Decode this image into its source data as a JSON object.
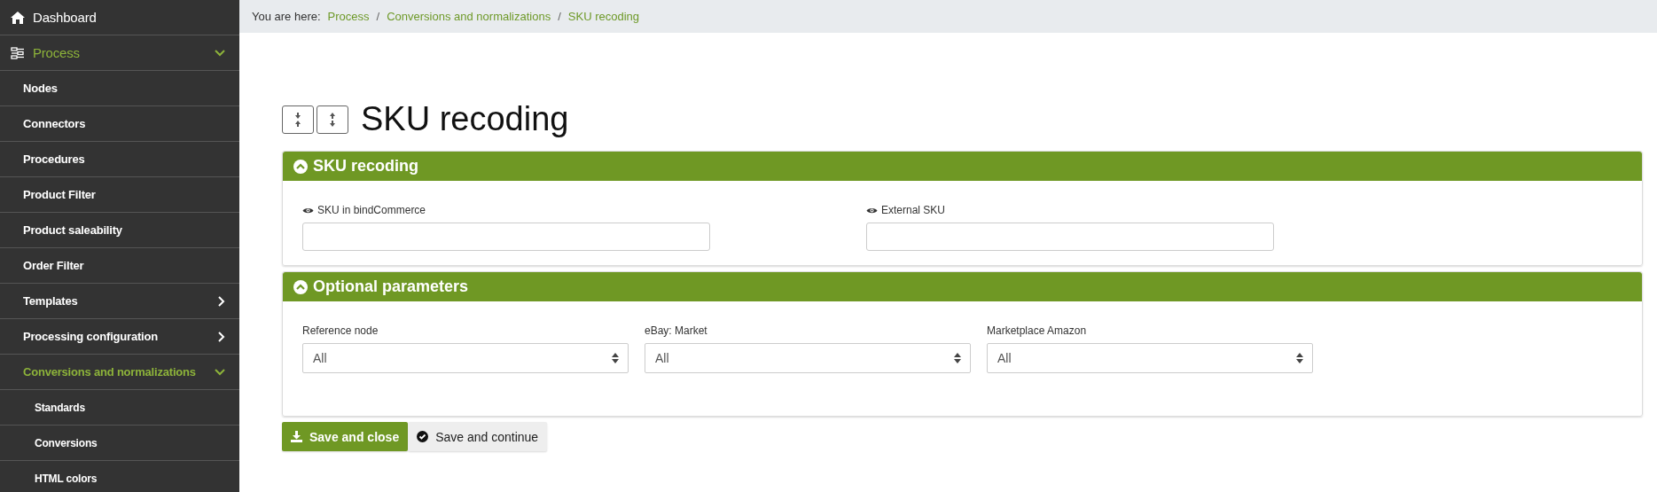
{
  "sidebar": {
    "items": [
      {
        "label": "Dashboard",
        "selected": false
      },
      {
        "label": "Process",
        "selected": true,
        "expanded": true,
        "children": [
          {
            "label": "Nodes",
            "selected": false
          },
          {
            "label": "Connectors",
            "selected": false
          },
          {
            "label": "Procedures",
            "selected": false
          },
          {
            "label": "Product Filter",
            "selected": false
          },
          {
            "label": "Product saleability",
            "selected": false
          },
          {
            "label": "Order Filter",
            "selected": false
          },
          {
            "label": "Templates",
            "selected": false,
            "expanded": false
          },
          {
            "label": "Processing configuration",
            "selected": false,
            "expanded": false
          },
          {
            "label": "Conversions and normalizations",
            "selected": true,
            "expanded": true,
            "children": [
              {
                "label": "Standards",
                "selected": false
              },
              {
                "label": "Conversions",
                "selected": false
              },
              {
                "label": "HTML colors",
                "selected": false
              }
            ]
          }
        ]
      }
    ]
  },
  "breadcrumb": {
    "prefix": "You are here:",
    "separator": "/",
    "items": [
      "Process",
      "Conversions and normalizations",
      "SKU recoding"
    ]
  },
  "page_title": "SKU recoding",
  "panels": [
    {
      "title": "SKU recoding",
      "expanded": true,
      "fields": [
        {
          "kind": "text",
          "label": "SKU in bindCommerce"
        },
        {
          "kind": "text",
          "label": "External SKU"
        }
      ]
    },
    {
      "title": "Optional parameters",
      "expanded": true,
      "fields": [
        {
          "kind": "select",
          "label": "Reference node",
          "value": "All"
        },
        {
          "kind": "select",
          "label": "eBay: Market",
          "value": "All"
        },
        {
          "kind": "select",
          "label": "Marketplace Amazon",
          "value": "All"
        }
      ]
    }
  ],
  "buttons": [
    {
      "kind": "primary",
      "label": "Save and close"
    },
    {
      "kind": "secondary",
      "label": "Save and continue"
    }
  ]
}
